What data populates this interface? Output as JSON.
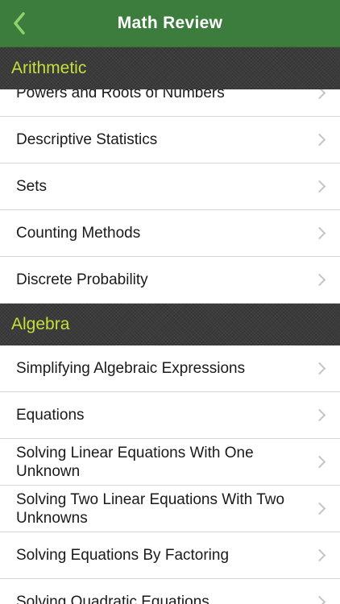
{
  "nav": {
    "title": "Math Review",
    "back_icon": "chevron-left-icon"
  },
  "colors": {
    "nav_background": "#3c7d3d",
    "section_text": "#c6df3a",
    "section_background": "#3b3b3b"
  },
  "sections": [
    {
      "title": "Arithmetic",
      "items": [
        "Powers and Roots of Numbers",
        "Descriptive Statistics",
        "Sets",
        "Counting Methods",
        "Discrete Probability"
      ]
    },
    {
      "title": "Algebra",
      "items": [
        "Simplifying Algebraic Expressions",
        "Equations",
        "Solving Linear Equations With One Unknown",
        "Solving Two Linear Equations With Two Unknowns",
        "Solving Equations By Factoring",
        "Solving Quadratic Equations"
      ]
    }
  ]
}
